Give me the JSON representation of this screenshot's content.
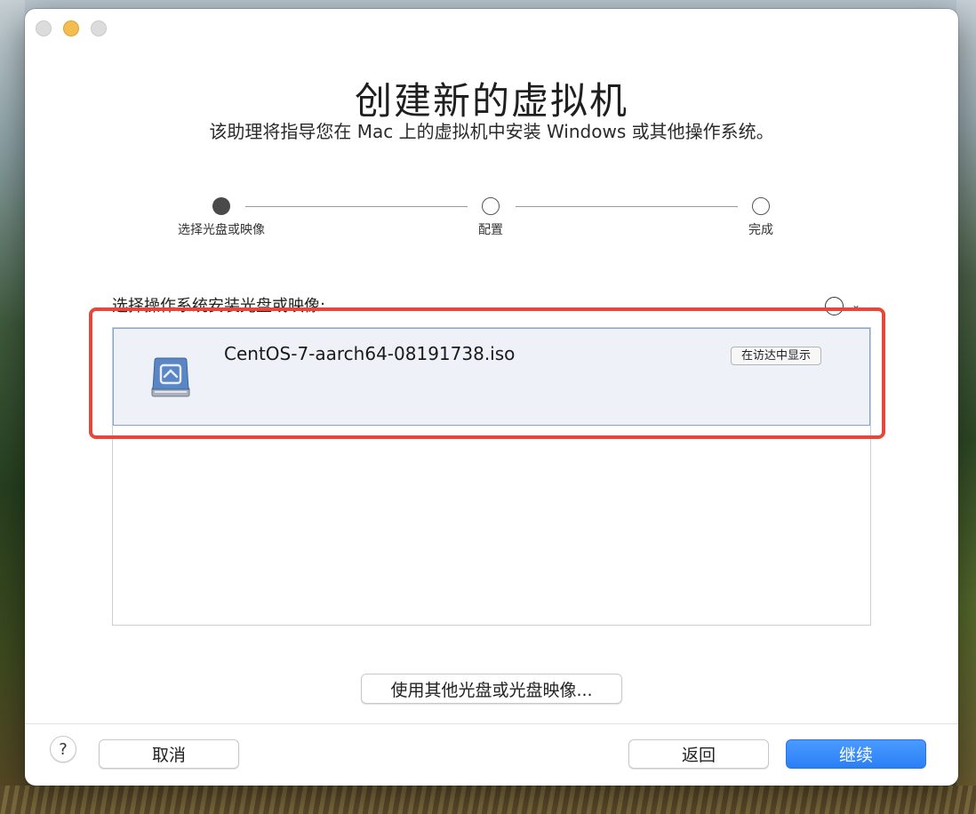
{
  "window": {
    "title": "创建新的虚拟机",
    "subtitle": "该助理将指导您在 Mac 上的虚拟机中安装 Windows 或其他操作系统。"
  },
  "steps": [
    {
      "label": "选择光盘或映像",
      "state": "active"
    },
    {
      "label": "配置",
      "state": "pending"
    },
    {
      "label": "完成",
      "state": "pending"
    }
  ],
  "section": {
    "label": "选择操作系统安装光盘或映像:"
  },
  "list": {
    "items": [
      {
        "name": "CentOS-7-aarch64-08191738.iso",
        "reveal_label": "在访达中显示",
        "icon": "disk-image-icon"
      }
    ]
  },
  "actions": {
    "other_disc": "使用其他光盘或光盘映像...",
    "help": "?",
    "cancel": "取消",
    "back": "返回",
    "continue": "继续"
  },
  "colors": {
    "accent": "#2b7ff5",
    "highlight": "#e2483b",
    "selection_bg": "#eef2f8"
  }
}
